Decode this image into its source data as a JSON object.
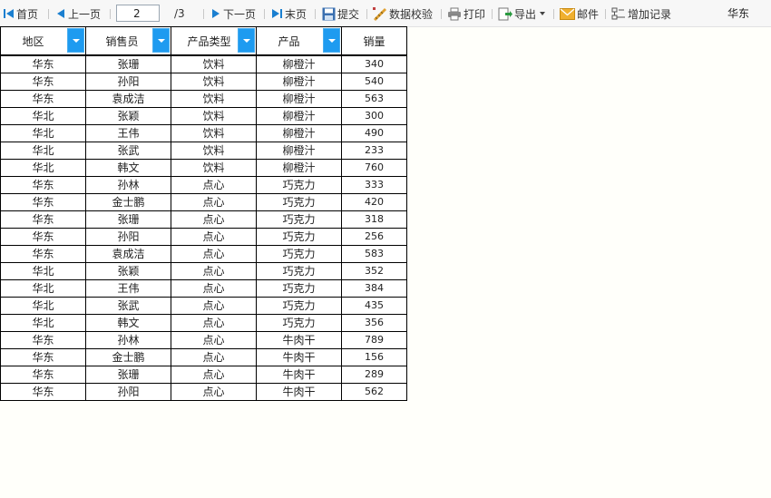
{
  "toolbar": {
    "first": "首页",
    "prev": "上一页",
    "page_value": "2",
    "page_total": "/3",
    "next": "下一页",
    "last": "末页",
    "submit": "提交",
    "validate": "数据校验",
    "print": "打印",
    "export": "导出",
    "mail": "邮件",
    "add_record": "增加记录",
    "region": "华东"
  },
  "table": {
    "headers": [
      "地区",
      "销售员",
      "产品类型",
      "产品",
      "销量"
    ],
    "rows": [
      [
        "华东",
        "张珊",
        "饮料",
        "柳橙汁",
        "340"
      ],
      [
        "华东",
        "孙阳",
        "饮料",
        "柳橙汁",
        "540"
      ],
      [
        "华东",
        "袁成洁",
        "饮料",
        "柳橙汁",
        "563"
      ],
      [
        "华北",
        "张颖",
        "饮料",
        "柳橙汁",
        "300"
      ],
      [
        "华北",
        "王伟",
        "饮料",
        "柳橙汁",
        "490"
      ],
      [
        "华北",
        "张武",
        "饮料",
        "柳橙汁",
        "233"
      ],
      [
        "华北",
        "韩文",
        "饮料",
        "柳橙汁",
        "760"
      ],
      [
        "华东",
        "孙林",
        "点心",
        "巧克力",
        "333"
      ],
      [
        "华东",
        "金士鹏",
        "点心",
        "巧克力",
        "420"
      ],
      [
        "华东",
        "张珊",
        "点心",
        "巧克力",
        "318"
      ],
      [
        "华东",
        "孙阳",
        "点心",
        "巧克力",
        "256"
      ],
      [
        "华东",
        "袁成洁",
        "点心",
        "巧克力",
        "583"
      ],
      [
        "华北",
        "张颖",
        "点心",
        "巧克力",
        "352"
      ],
      [
        "华北",
        "王伟",
        "点心",
        "巧克力",
        "384"
      ],
      [
        "华北",
        "张武",
        "点心",
        "巧克力",
        "435"
      ],
      [
        "华北",
        "韩文",
        "点心",
        "巧克力",
        "356"
      ],
      [
        "华东",
        "孙林",
        "点心",
        "牛肉干",
        "789"
      ],
      [
        "华东",
        "金士鹏",
        "点心",
        "牛肉干",
        "156"
      ],
      [
        "华东",
        "张珊",
        "点心",
        "牛肉干",
        "289"
      ],
      [
        "华东",
        "孙阳",
        "点心",
        "牛肉干",
        "562"
      ]
    ]
  },
  "colors": {
    "nav_arrow": "#1a7fd0",
    "filter_button": "#1e9bf0",
    "mail_icon": "#f0b030"
  }
}
